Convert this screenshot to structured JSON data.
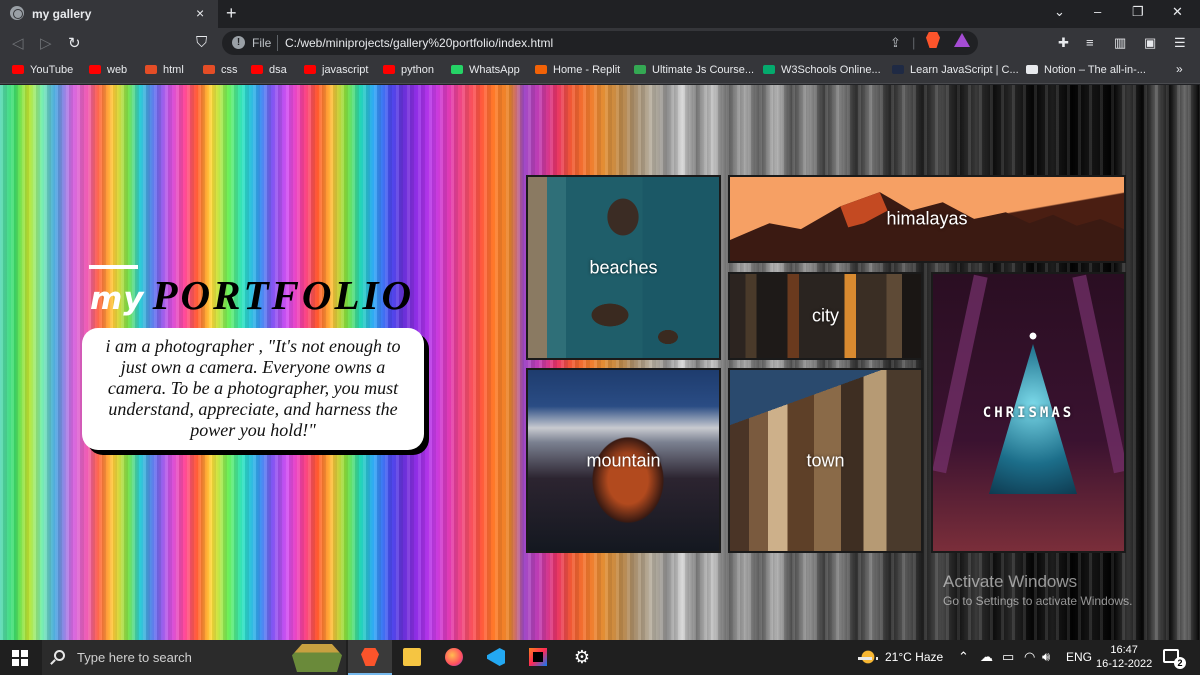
{
  "browser": {
    "tab_title": "my gallery",
    "tab_close": "×",
    "new_tab": "+",
    "window_controls": [
      "⌄",
      "–",
      "❐",
      "✕"
    ],
    "file_label": "File",
    "url": "C:/web/miniprojects/gallery%20portfolio/index.html",
    "bookmarks": [
      {
        "label": "YouTube",
        "icon": "youtube-icon"
      },
      {
        "label": "web",
        "icon": "youtube-icon"
      },
      {
        "label": "html",
        "icon": "html5-icon"
      },
      {
        "label": "css",
        "icon": "html5-icon"
      },
      {
        "label": "dsa",
        "icon": "youtube-icon"
      },
      {
        "label": "javascript",
        "icon": "youtube-icon"
      },
      {
        "label": "python",
        "icon": "youtube-icon"
      },
      {
        "label": "WhatsApp",
        "icon": "whatsapp-icon"
      },
      {
        "label": "Home - Replit",
        "icon": "replit-icon"
      },
      {
        "label": "Ultimate Js Course...",
        "icon": "google-drive-icon"
      },
      {
        "label": "W3Schools Online...",
        "icon": "w3schools-icon"
      },
      {
        "label": "Learn JavaScript | C...",
        "icon": "codecademy-icon"
      },
      {
        "label": "Notion – The all-in-...",
        "icon": "notion-icon"
      }
    ],
    "bookmarks_more": "»"
  },
  "page": {
    "title_my": "my",
    "title_portfolio": "PORTFOLIO",
    "quote": "i am a photographer , \"It's not enough to just own a camera. Everyone owns a camera. To be a photographer, you must understand, appreciate, and harness the power you hold!\"",
    "gallery": {
      "beaches": "beaches",
      "himalayas": "himalayas",
      "city": "city",
      "christmas": "CHRISMAS",
      "mountain": "mountain",
      "town": "town"
    },
    "watermark": {
      "title": "Activate Windows",
      "subtitle": "Go to Settings to activate Windows."
    }
  },
  "taskbar": {
    "search_placeholder": "Type here to search",
    "weather": "21°C  Haze",
    "language": "ENG",
    "time": "16:47",
    "date": "16-12-2022",
    "notification_count": "2"
  }
}
